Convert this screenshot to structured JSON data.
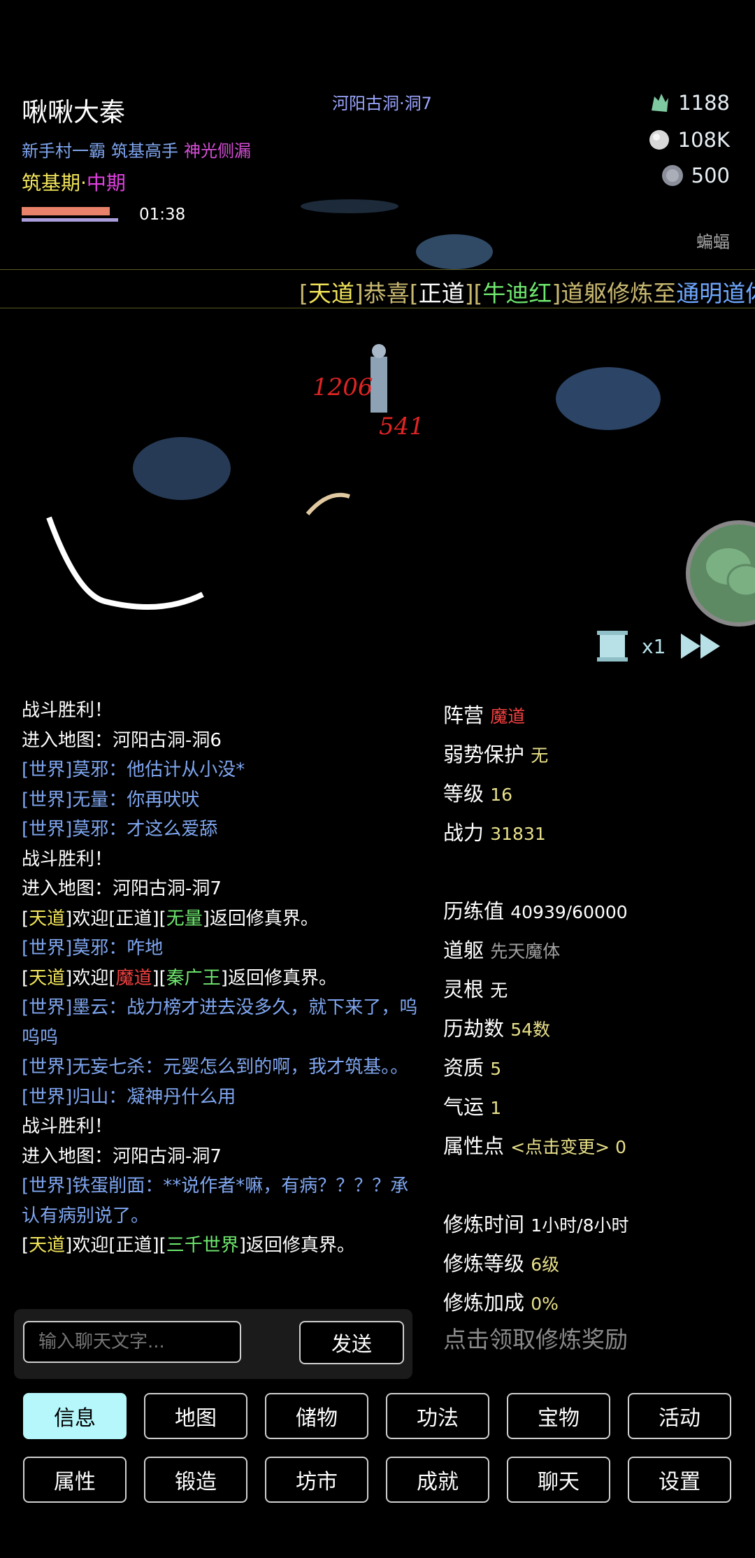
{
  "player": {
    "name": "啾啾大秦",
    "titles": [
      {
        "text": "新手村一霸",
        "color": "#7fa6f0"
      },
      {
        "text": "筑基高手",
        "color": "#7fa6f0"
      },
      {
        "text": "神光侧漏",
        "color": "#d64ed7"
      }
    ],
    "realm_main": "筑基期·",
    "realm_sub": "中期",
    "timer": "01:38"
  },
  "map_name": "河阳古洞·洞7",
  "resources": [
    {
      "icon": "jade-icon",
      "value": "1188"
    },
    {
      "icon": "silver-icon",
      "value": "108K"
    },
    {
      "icon": "stone-icon",
      "value": "500"
    }
  ],
  "enemy_label": "蝙蝠",
  "marquee": [
    {
      "text": "[",
      "color": "#c8b870"
    },
    {
      "text": "天道",
      "color": "#f2e55a"
    },
    {
      "text": "]恭喜[",
      "color": "#c8b870"
    },
    {
      "text": "正道",
      "color": "#ffffff"
    },
    {
      "text": "][",
      "color": "#c8b870"
    },
    {
      "text": "牛迪红",
      "color": "#6fe86f"
    },
    {
      "text": "]道躯修炼至",
      "color": "#c8b870"
    },
    {
      "text": "通明道体",
      "color": "#6fa8ff"
    },
    {
      "text": "！",
      "color": "#c8b870"
    }
  ],
  "damage": [
    "1206",
    "541"
  ],
  "speed": "x1",
  "log": [
    [
      {
        "t": "战斗胜利！",
        "c": "#ffffff"
      }
    ],
    [
      {
        "t": "进入地图：河阳古洞-洞6",
        "c": "#ffffff"
      }
    ],
    [
      {
        "t": "[世界]莫邪：他估计从小没*",
        "c": "#7fa6f0"
      }
    ],
    [
      {
        "t": "[世界]无量：你再吠吠",
        "c": "#7fa6f0"
      }
    ],
    [
      {
        "t": "[世界]莫邪：才这么爱舔",
        "c": "#7fa6f0"
      }
    ],
    [
      {
        "t": "战斗胜利！",
        "c": "#ffffff"
      }
    ],
    [
      {
        "t": "进入地图：河阳古洞-洞7",
        "c": "#ffffff"
      }
    ],
    [
      {
        "t": "[",
        "c": "#ffffff"
      },
      {
        "t": "天道",
        "c": "#f2e55a"
      },
      {
        "t": "]欢迎[正道][",
        "c": "#ffffff"
      },
      {
        "t": "无量",
        "c": "#6fe86f"
      },
      {
        "t": "]返回修真界。",
        "c": "#ffffff"
      }
    ],
    [
      {
        "t": "[世界]莫邪：咋地",
        "c": "#7fa6f0"
      }
    ],
    [
      {
        "t": "[",
        "c": "#ffffff"
      },
      {
        "t": "天道",
        "c": "#f2e55a"
      },
      {
        "t": "]欢迎[",
        "c": "#ffffff"
      },
      {
        "t": "魔道",
        "c": "#f04040"
      },
      {
        "t": "][",
        "c": "#ffffff"
      },
      {
        "t": "秦广王",
        "c": "#6fe86f"
      },
      {
        "t": "]返回修真界。",
        "c": "#ffffff"
      }
    ],
    [
      {
        "t": "[世界]墨云：战力榜才进去没多久，就下来了，呜呜呜",
        "c": "#7fa6f0"
      }
    ],
    [
      {
        "t": "[世界]无妄七杀：元婴怎么到的啊，我才筑基。。",
        "c": "#7fa6f0"
      }
    ],
    [
      {
        "t": "[世界]归山：凝神丹什么用",
        "c": "#7fa6f0"
      }
    ],
    [
      {
        "t": "战斗胜利！",
        "c": "#ffffff"
      }
    ],
    [
      {
        "t": "进入地图：河阳古洞-洞7",
        "c": "#ffffff"
      }
    ],
    [
      {
        "t": "[世界]铁蛋削面：**说作者*嘛，有病？？？？承认有病别说了。",
        "c": "#7fa6f0"
      }
    ],
    [
      {
        "t": "[",
        "c": "#ffffff"
      },
      {
        "t": "天道",
        "c": "#f2e55a"
      },
      {
        "t": "]欢迎[正道][",
        "c": "#ffffff"
      },
      {
        "t": "三千世界",
        "c": "#6fe86f"
      },
      {
        "t": "]返回修真界。",
        "c": "#ffffff"
      }
    ]
  ],
  "stats": [
    {
      "label": "阵营",
      "value": "魔道",
      "color": "#f04040"
    },
    {
      "label": "弱势保护",
      "value": "无",
      "color": "#e8e08a"
    },
    {
      "label": "等级",
      "value": "16",
      "color": "#e8e08a"
    },
    {
      "label": "战力",
      "value": "31831",
      "color": "#e8e08a"
    },
    {
      "label": "",
      "value": "",
      "color": "#ffffff"
    },
    {
      "label": "历练值",
      "value": "40939/60000",
      "color": "#ffffff"
    },
    {
      "label": "道躯",
      "value": "先天魔体",
      "color": "#a0a0a0"
    },
    {
      "label": "灵根",
      "value": "无",
      "color": "#ffffff"
    },
    {
      "label": "历劫数",
      "value": "54数",
      "color": "#e8e08a"
    },
    {
      "label": "资质",
      "value": "5",
      "color": "#e8e08a"
    },
    {
      "label": "气运",
      "value": "1",
      "color": "#e8e08a"
    },
    {
      "label": "属性点",
      "value": "<点击变更> 0",
      "color": "#e8e08a"
    },
    {
      "label": "",
      "value": "",
      "color": "#ffffff"
    },
    {
      "label": "修炼时间",
      "value": "1小时/8小时",
      "color": "#ffffff"
    },
    {
      "label": "修炼等级",
      "value": "6级",
      "color": "#e8e08a"
    },
    {
      "label": "修炼加成",
      "value": "0%",
      "color": "#e8e08a"
    }
  ],
  "chat": {
    "placeholder": "输入聊天文字...",
    "send": "发送"
  },
  "reward_text": "点击领取修炼奖励",
  "tabs_row1": [
    "信息",
    "地图",
    "储物",
    "功法",
    "宝物",
    "活动"
  ],
  "tabs_row2": [
    "属性",
    "锻造",
    "坊市",
    "成就",
    "聊天",
    "设置"
  ]
}
